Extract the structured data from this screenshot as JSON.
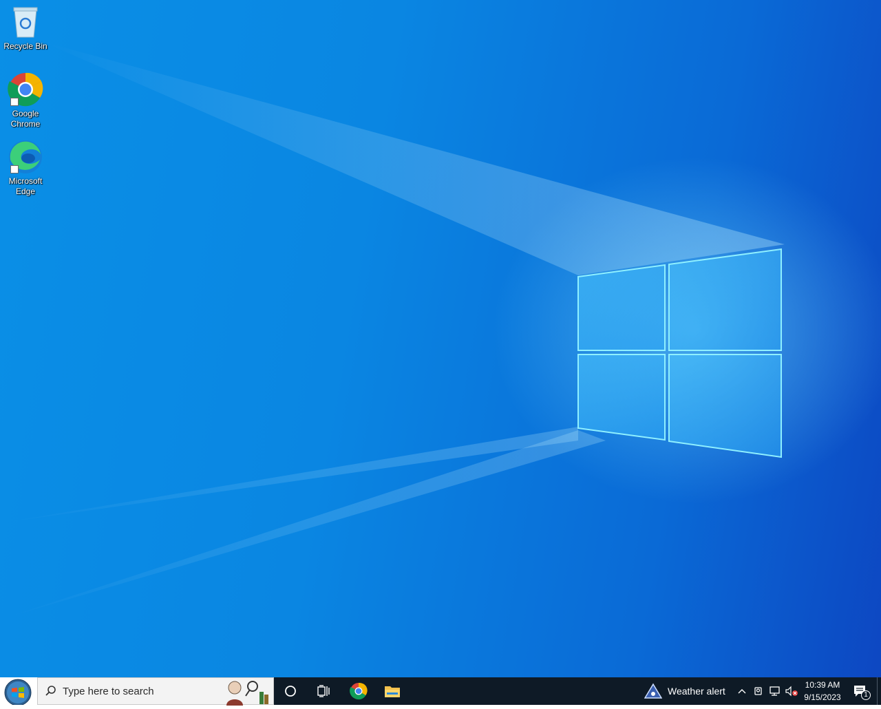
{
  "desktop": {
    "icons": [
      {
        "label": "Recycle Bin",
        "icon": "recycle-bin-icon"
      },
      {
        "label": "Google Chrome",
        "icon": "chrome-icon"
      },
      {
        "label": "Microsoft Edge",
        "icon": "edge-icon"
      }
    ],
    "wallpaper": {
      "accent": "#0a86e2",
      "logo_color": "#7fd8ff"
    }
  },
  "taskbar": {
    "start_icon": "windows-orb-icon",
    "search": {
      "placeholder": "Type here to search",
      "icon": "search-icon"
    },
    "pinned": [
      {
        "name": "cortana",
        "icon": "cortana-circle-icon"
      },
      {
        "name": "task-view",
        "icon": "task-view-icon"
      },
      {
        "name": "chrome",
        "icon": "chrome-icon"
      },
      {
        "name": "file-explorer",
        "icon": "folder-icon"
      }
    ],
    "weather": {
      "label": "Weather alert",
      "icon": "weather-alert-icon"
    },
    "tray": {
      "icons": [
        "chevron-up-icon",
        "meet-now-icon",
        "network-icon",
        "volume-muted-icon"
      ]
    },
    "clock": {
      "time": "10:39 AM",
      "date": "9/15/2023"
    },
    "notifications": {
      "count": "1",
      "icon": "action-center-icon"
    },
    "colors": {
      "background": "#0e1a26"
    }
  }
}
